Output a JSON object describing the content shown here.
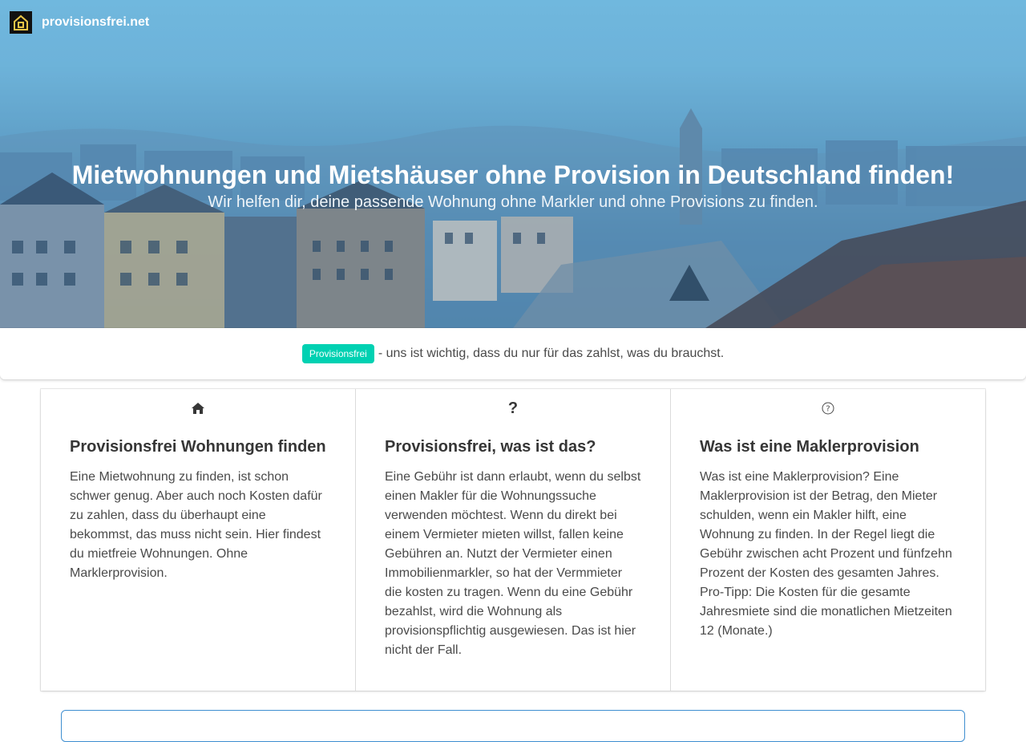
{
  "brand": {
    "name": "provisionsfrei.net",
    "logo": "house-icon"
  },
  "hero": {
    "title": "Mietwohnungen und Mietshäuser ohne Provision in Deutschland finden!",
    "subtitle": "Wir helfen dir, deine passende Wohnung ohne Markler und ohne Provisions zu finden."
  },
  "tagline": {
    "tag": "Provisionsfrei",
    "text": "- uns ist wichtig, dass du nur für das zahlst, was du brauchst."
  },
  "cards": [
    {
      "icon": "home-icon",
      "title": "Provisionsfrei Wohnungen finden",
      "body": "Eine Mietwohnung zu finden, ist schon schwer genug. Aber auch noch Kosten dafür zu zahlen, dass du überhaupt eine bekommst, das muss nicht sein. Hier findest du mietfreie Wohnungen. Ohne Marklerprovision."
    },
    {
      "icon": "question-icon",
      "title": "Provisionsfrei, was ist das?",
      "body": "Eine Gebühr ist dann erlaubt, wenn du selbst einen Makler für die Wohnungssuche verwenden möchtest. Wenn du direkt bei einem Vermieter mieten willst, fallen keine Gebühren an. Nutzt der Vermieter einen Immobilienmarkler, so hat der Vermmieter die kosten zu tragen. Wenn du eine Gebühr bezahlst, wird die Wohnung als provisionspflichtig ausgewiesen. Das ist hier nicht der Fall."
    },
    {
      "icon": "question-circle-icon",
      "title": "Was ist eine Maklerprovision",
      "body": "Was ist eine Maklerprovision? Eine Maklerprovision ist der Betrag, den Mieter schulden, wenn ein Makler hilft, eine Wohnung zu finden. In der Regel liegt die Gebühr zwischen acht Prozent und fünfzehn Prozent der Kosten des gesamten Jahres. Pro-Tipp: Die Kosten für die gesamte Jahresmiete sind die monatlichen Mietzeiten 12 (Monate.)"
    }
  ],
  "colors": {
    "accent": "#00d1b2",
    "link": "#3e8ed0",
    "text": "#4a4a4a",
    "heading": "#363636"
  }
}
